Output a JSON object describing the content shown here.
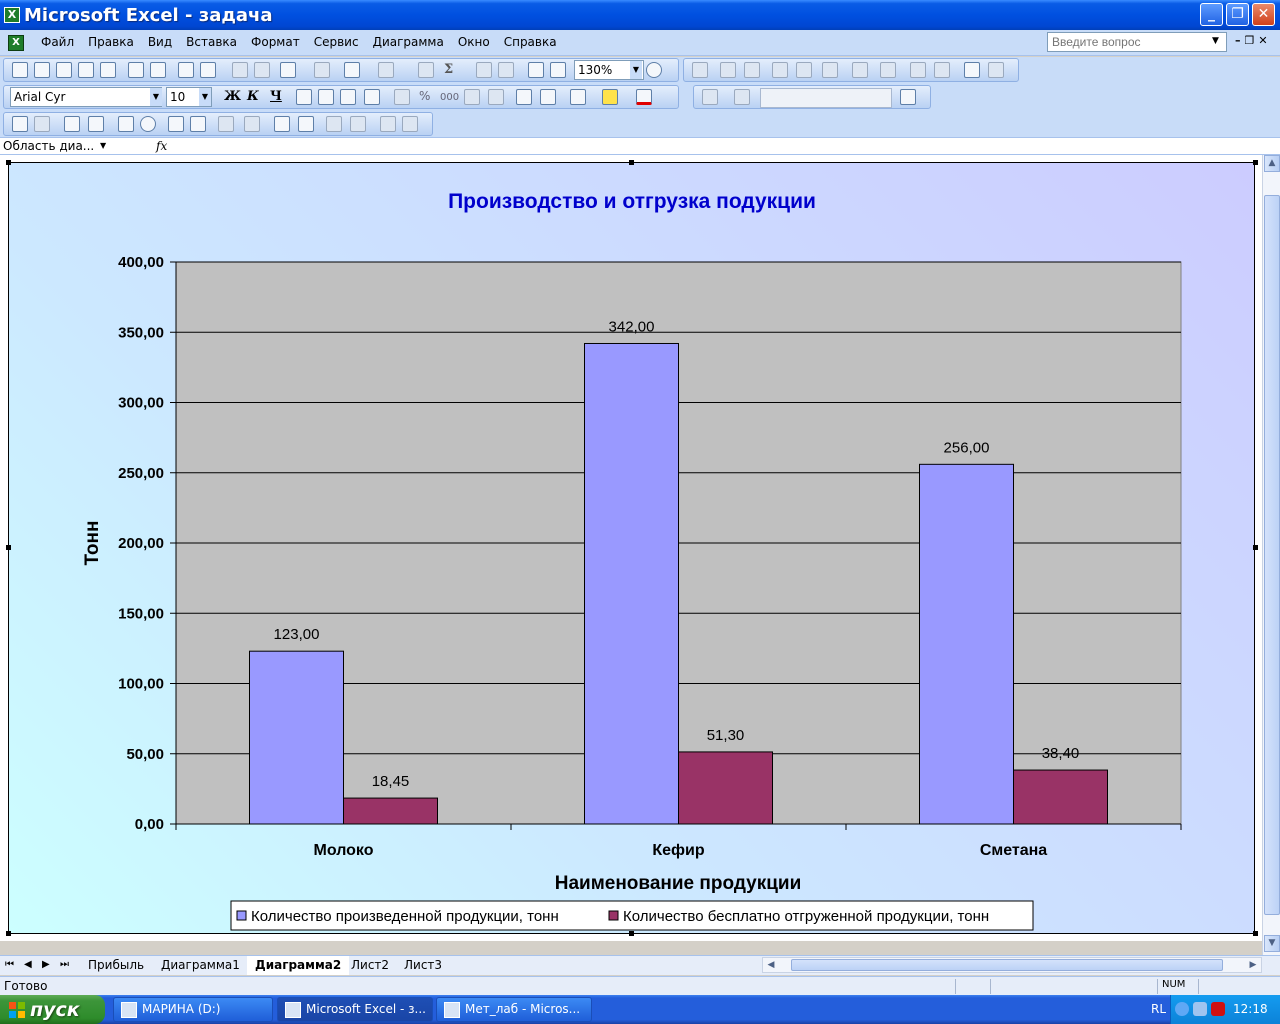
{
  "window": {
    "title": "Microsoft Excel - задача",
    "app_icon": "excel-icon",
    "min_glyph": "_",
    "max_glyph": "❐",
    "close_glyph": "✕"
  },
  "menu": [
    "Файл",
    "Правка",
    "Вид",
    "Вставка",
    "Формат",
    "Сервис",
    "Диаграмма",
    "Окно",
    "Справка"
  ],
  "help_placeholder": "Введите вопрос",
  "toolbar": {
    "zoom": "130%",
    "font_name": "Arial Cyr",
    "font_size": "10",
    "bold": "Ж",
    "italic": "К",
    "underline": "Ч",
    "percent": "%",
    "thousands": "000",
    "sigma": "Σ"
  },
  "formula_bar": {
    "name_box": "Область диа...",
    "fx": "fx"
  },
  "chart_data": {
    "type": "bar",
    "title": "Производство и отгрузка подукции",
    "xlabel": "Наименование продукции",
    "ylabel": "Тонн",
    "categories": [
      "Молоко",
      "Кефир",
      "Сметана"
    ],
    "series": [
      {
        "name": "Количество произведенной продукции, тонн",
        "values": [
          123.0,
          342.0,
          256.0
        ],
        "labels": [
          "123,00",
          "342,00",
          "256,00"
        ],
        "color": "#9999ff"
      },
      {
        "name": "Количество бесплатно отгруженной продукции, тонн",
        "values": [
          18.45,
          51.3,
          38.4
        ],
        "labels": [
          "18,45",
          "51,30",
          "38,40"
        ],
        "color": "#993366"
      }
    ],
    "ylim": [
      0,
      400
    ],
    "ytick_labels": [
      "0,00",
      "50,00",
      "100,00",
      "150,00",
      "200,00",
      "250,00",
      "300,00",
      "350,00",
      "400,00"
    ],
    "grid": true,
    "plot_background": "#c0c0c0",
    "title_color": "#0000cc",
    "legend_position": "bottom"
  },
  "sheet_tabs": [
    {
      "label": "Прибыль",
      "active": false
    },
    {
      "label": "Диаграмма1",
      "active": false
    },
    {
      "label": "Диаграмма2",
      "active": true
    },
    {
      "label": "Лист2",
      "active": false
    },
    {
      "label": "Лист3",
      "active": false
    }
  ],
  "status": {
    "ready": "Готово",
    "num": "NUM"
  },
  "taskbar": {
    "start": "пуск",
    "tasks": [
      {
        "label": "МАРИНА (D:)",
        "active": false
      },
      {
        "label": "Microsoft Excel - з...",
        "active": true
      },
      {
        "label": "Мет_лаб - Micros...",
        "active": false
      }
    ],
    "lang": "RL",
    "time": "12:18"
  }
}
